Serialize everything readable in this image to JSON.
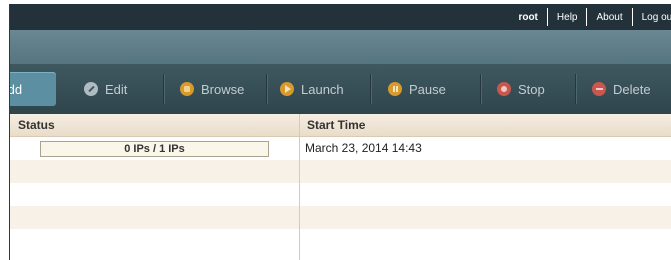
{
  "topbar": {
    "user": "root",
    "links": [
      "Help",
      "About",
      "Log out"
    ]
  },
  "toolbar": {
    "add": "Add",
    "edit": "Edit",
    "browse": "Browse",
    "launch": "Launch",
    "pause": "Pause",
    "stop": "Stop",
    "delete": "Delete"
  },
  "icons": {
    "edit": "edit-icon",
    "browse": "browse-icon",
    "launch": "launch-icon",
    "pause": "pause-icon",
    "stop": "stop-icon",
    "delete": "delete-icon"
  },
  "table": {
    "columns": [
      "Status",
      "Start Time"
    ],
    "rows": [
      {
        "status": "0 IPs / 1 IPs",
        "start_time": "March 23, 2014 14:43"
      }
    ]
  },
  "colors": {
    "topbar": "#23323a",
    "header": "#5f7f8a",
    "toolbar": "#3a5158",
    "accent": "#5b8fa1"
  }
}
